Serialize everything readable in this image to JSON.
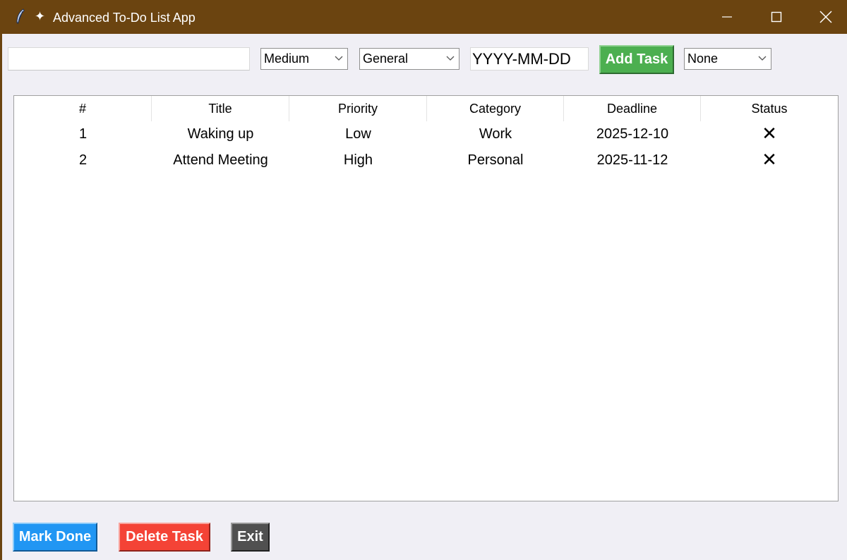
{
  "window": {
    "title": "Advanced To-Do List App",
    "icon_names": [
      "feather-icon",
      "sparkle-icon",
      "minimize-icon",
      "maximize-icon",
      "close-icon"
    ]
  },
  "toolbar": {
    "title_value": "",
    "priority_selected": "Medium",
    "category_selected": "General",
    "deadline_placeholder": "YYYY-MM-DD",
    "add_label": "Add Task",
    "filter_selected": "None"
  },
  "table": {
    "headers": [
      "#",
      "Title",
      "Priority",
      "Category",
      "Deadline",
      "Status"
    ],
    "rows": [
      {
        "num": "1",
        "title": "Waking up",
        "priority": "Low",
        "category": "Work",
        "deadline": "2025-12-10",
        "status": "✕"
      },
      {
        "num": "2",
        "title": "Attend Meeting",
        "priority": "High",
        "category": "Personal",
        "deadline": "2025-11-12",
        "status": "✕"
      }
    ]
  },
  "actions": {
    "mark_done_label": "Mark Done",
    "delete_label": "Delete Task",
    "exit_label": "Exit"
  },
  "colors": {
    "titlebar": "#6b4410",
    "add_button": "#4caf50",
    "mark_done": "#2196f3",
    "delete": "#f44336",
    "exit": "#505050"
  }
}
